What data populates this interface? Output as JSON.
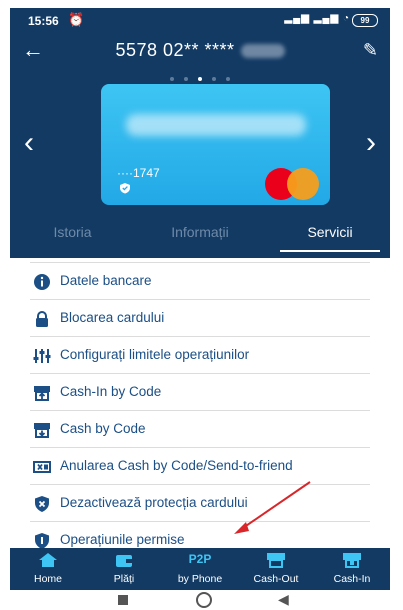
{
  "status": {
    "time": "15:56",
    "battery": "99"
  },
  "header": {
    "title": "5578 02** ****"
  },
  "card": {
    "number": "····1747"
  },
  "tabs": [
    {
      "label": "Istoria"
    },
    {
      "label": "Informații"
    },
    {
      "label": "Servicii"
    }
  ],
  "services": [
    {
      "label": "Datele bancare",
      "icon": "info-icon"
    },
    {
      "label": "Blocarea cardului",
      "icon": "lock-icon"
    },
    {
      "label": "Configurați limitele operațiunilor",
      "icon": "sliders-icon"
    },
    {
      "label": "Cash-In by Code",
      "icon": "cash-in-icon"
    },
    {
      "label": "Cash by Code",
      "icon": "cash-code-icon"
    },
    {
      "label": "Anularea Cash by Code/Send-to-friend",
      "icon": "cancel-cash-icon"
    },
    {
      "label": "Dezactivează protecția cardului",
      "icon": "shield-x-icon"
    },
    {
      "label": "Operațiunile permise",
      "icon": "shield-icon"
    }
  ],
  "nav": [
    {
      "label": "Home",
      "icon": "home-icon"
    },
    {
      "label": "Plăți",
      "icon": "wallet-icon"
    },
    {
      "label": "by Phone",
      "top": "P2P"
    },
    {
      "label": "Cash-Out",
      "icon": "atm-out-icon"
    },
    {
      "label": "Cash-In",
      "icon": "atm-in-icon"
    }
  ],
  "colors": {
    "primary": "#123a63",
    "accent": "#3ec5f3",
    "text": "#1b4f86",
    "annotation": "#d9262a"
  }
}
